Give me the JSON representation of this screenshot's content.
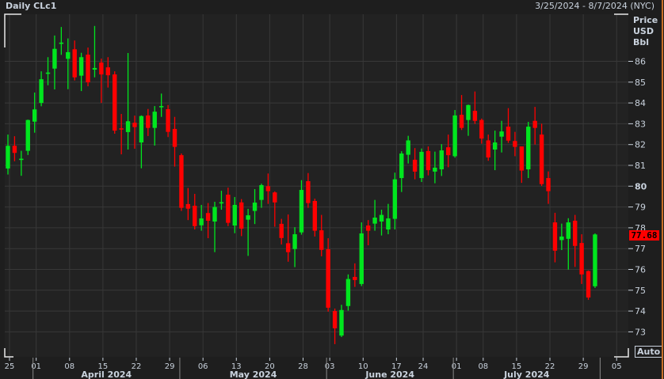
{
  "header": {
    "title": "Daily CLc1",
    "date_range": "3/25/2024 - 8/7/2024 (NYC)"
  },
  "axis_unit": [
    "Price",
    "USD",
    "Bbl"
  ],
  "auto_button": "Auto",
  "last_price": "77.68",
  "colors": {
    "up": "#00e61e",
    "down": "#ff0000",
    "background": "#222222",
    "grid": "#383838",
    "last_price_tag": "#ff0000",
    "axis_text": "#c9d2dd"
  },
  "chart_data": {
    "type": "candlestick",
    "title": "Daily CLc1",
    "ylabel": "Price USD Bbl",
    "ylim": [
      72.3,
      87.8
    ],
    "y_ticks": [
      73,
      74,
      75,
      76,
      77,
      78,
      79,
      80,
      81,
      82,
      83,
      84,
      85,
      86
    ],
    "grid": true,
    "x_ticks": [
      {
        "date": "2024-03-25",
        "label": "25"
      },
      {
        "date": "2024-04-01",
        "label": "01"
      },
      {
        "date": "2024-04-08",
        "label": "08"
      },
      {
        "date": "2024-04-15",
        "label": "15"
      },
      {
        "date": "2024-04-22",
        "label": "22"
      },
      {
        "date": "2024-04-29",
        "label": "29"
      },
      {
        "date": "2024-05-06",
        "label": "06"
      },
      {
        "date": "2024-05-13",
        "label": "13"
      },
      {
        "date": "2024-05-20",
        "label": "20"
      },
      {
        "date": "2024-05-28",
        "label": "28"
      },
      {
        "date": "2024-06-03",
        "label": "03"
      },
      {
        "date": "2024-06-10",
        "label": "10"
      },
      {
        "date": "2024-06-17",
        "label": "17"
      },
      {
        "date": "2024-06-24",
        "label": "24"
      },
      {
        "date": "2024-07-01",
        "label": "01"
      },
      {
        "date": "2024-07-08",
        "label": "08"
      },
      {
        "date": "2024-07-15",
        "label": "15"
      },
      {
        "date": "2024-07-22",
        "label": "22"
      },
      {
        "date": "2024-07-29",
        "label": "29"
      },
      {
        "date": "2024-08-05",
        "label": "05"
      }
    ],
    "months": [
      {
        "start": "2024-04-01",
        "label": "April 2024"
      },
      {
        "start": "2024-05-01",
        "label": "May 2024"
      },
      {
        "start": "2024-06-03",
        "label": "June 2024"
      },
      {
        "start": "2024-07-01",
        "label": "July 2024"
      },
      {
        "start": "2024-08-01",
        "label": ""
      }
    ],
    "columns": [
      "date",
      "open",
      "high",
      "low",
      "close"
    ],
    "candles": [
      [
        "2024-03-25",
        80.85,
        82.48,
        80.56,
        81.94
      ],
      [
        "2024-03-26",
        81.94,
        82.4,
        81.2,
        81.6
      ],
      [
        "2024-03-27",
        81.3,
        81.7,
        80.5,
        81.32
      ],
      [
        "2024-03-28",
        81.7,
        83.2,
        81.5,
        83.18
      ],
      [
        "2024-04-01",
        83.1,
        84.5,
        82.57,
        83.69
      ],
      [
        "2024-04-02",
        84.0,
        85.52,
        83.84,
        85.14
      ],
      [
        "2024-04-03",
        85.46,
        86.2,
        84.85,
        85.46
      ],
      [
        "2024-04-04",
        85.65,
        87.24,
        84.65,
        86.6
      ],
      [
        "2024-04-05",
        86.9,
        87.65,
        86.31,
        86.9
      ],
      [
        "2024-04-08",
        86.12,
        87.1,
        84.66,
        86.44
      ],
      [
        "2024-04-09",
        86.58,
        87.0,
        85.08,
        85.23
      ],
      [
        "2024-04-10",
        85.31,
        86.41,
        84.57,
        86.2
      ],
      [
        "2024-04-11",
        86.32,
        86.66,
        84.8,
        84.99
      ],
      [
        "2024-04-12",
        85.6,
        87.7,
        85.23,
        85.68
      ],
      [
        "2024-04-15",
        85.94,
        86.13,
        84.0,
        85.37
      ],
      [
        "2024-04-16",
        85.71,
        86.2,
        84.74,
        85.33
      ],
      [
        "2024-04-17",
        85.37,
        85.52,
        82.52,
        82.67
      ],
      [
        "2024-04-18",
        82.78,
        83.47,
        81.53,
        82.74
      ],
      [
        "2024-04-19",
        82.6,
        86.4,
        81.76,
        83.12
      ],
      [
        "2024-04-22",
        83.05,
        83.39,
        81.8,
        82.84
      ],
      [
        "2024-04-23",
        82.1,
        83.4,
        80.86,
        83.37
      ],
      [
        "2024-04-24",
        83.4,
        83.71,
        82.41,
        82.8
      ],
      [
        "2024-04-25",
        82.8,
        83.85,
        81.95,
        83.58
      ],
      [
        "2024-04-26",
        83.8,
        84.45,
        83.33,
        83.85
      ],
      [
        "2024-04-29",
        83.7,
        83.9,
        82.36,
        82.61
      ],
      [
        "2024-04-30",
        82.75,
        83.33,
        80.94,
        81.89
      ],
      [
        "2024-05-01",
        81.49,
        81.57,
        78.81,
        78.96
      ],
      [
        "2024-05-02",
        79.14,
        79.91,
        78.37,
        78.92
      ],
      [
        "2024-05-03",
        79.06,
        79.63,
        77.92,
        78.08
      ],
      [
        "2024-05-06",
        78.12,
        79.1,
        77.86,
        78.45
      ],
      [
        "2024-05-07",
        78.71,
        79.19,
        77.5,
        78.34
      ],
      [
        "2024-05-08",
        78.3,
        79.25,
        76.83,
        79.0
      ],
      [
        "2024-05-09",
        79.18,
        79.78,
        78.87,
        79.23
      ],
      [
        "2024-05-10",
        79.59,
        79.93,
        78.08,
        78.24
      ],
      [
        "2024-05-13",
        78.11,
        79.48,
        77.74,
        79.1
      ],
      [
        "2024-05-14",
        79.22,
        79.38,
        77.6,
        77.96
      ],
      [
        "2024-05-15",
        78.39,
        78.91,
        76.65,
        78.6
      ],
      [
        "2024-05-16",
        78.81,
        79.86,
        78.18,
        79.21
      ],
      [
        "2024-05-17",
        79.34,
        80.12,
        78.96,
        80.05
      ],
      [
        "2024-05-20",
        80.0,
        80.61,
        79.15,
        79.76
      ],
      [
        "2024-05-21",
        79.7,
        79.75,
        78.05,
        79.22
      ],
      [
        "2024-05-22",
        78.19,
        78.43,
        77.2,
        77.51
      ],
      [
        "2024-05-23",
        77.26,
        78.64,
        76.37,
        76.83
      ],
      [
        "2024-05-24",
        76.98,
        78.03,
        76.11,
        77.69
      ],
      [
        "2024-05-28",
        77.78,
        80.29,
        77.67,
        79.82
      ],
      [
        "2024-05-29",
        80.24,
        80.63,
        78.96,
        79.19
      ],
      [
        "2024-05-30",
        79.29,
        79.4,
        77.58,
        77.86
      ],
      [
        "2024-05-31",
        77.88,
        78.62,
        76.63,
        76.94
      ],
      [
        "2024-06-03",
        76.97,
        77.5,
        73.97,
        74.16
      ],
      [
        "2024-06-04",
        74.0,
        74.12,
        72.41,
        73.17
      ],
      [
        "2024-06-05",
        72.82,
        74.3,
        72.75,
        74.05
      ],
      [
        "2024-06-06",
        74.24,
        75.76,
        74.02,
        75.54
      ],
      [
        "2024-06-07",
        75.64,
        76.29,
        75.16,
        75.49
      ],
      [
        "2024-06-10",
        75.3,
        78.26,
        75.2,
        77.73
      ],
      [
        "2024-06-11",
        78.11,
        78.37,
        77.16,
        77.86
      ],
      [
        "2024-06-12",
        78.2,
        79.34,
        77.86,
        78.49
      ],
      [
        "2024-06-13",
        78.3,
        78.87,
        77.63,
        78.62
      ],
      [
        "2024-06-14",
        77.92,
        79.15,
        77.69,
        78.45
      ],
      [
        "2024-06-17",
        78.43,
        80.65,
        77.92,
        80.33
      ],
      [
        "2024-06-18",
        80.39,
        81.68,
        79.72,
        81.57
      ],
      [
        "2024-06-20",
        81.51,
        82.42,
        81.09,
        82.2
      ],
      [
        "2024-06-21",
        81.27,
        81.83,
        80.33,
        80.7
      ],
      [
        "2024-06-24",
        80.39,
        81.81,
        80.2,
        81.65
      ],
      [
        "2024-06-25",
        81.69,
        81.91,
        80.52,
        80.77
      ],
      [
        "2024-06-26",
        80.7,
        81.66,
        80.14,
        80.89
      ],
      [
        "2024-06-27",
        80.81,
        82.02,
        80.49,
        81.72
      ],
      [
        "2024-06-28",
        81.87,
        82.48,
        80.91,
        81.49
      ],
      [
        "2024-07-01",
        81.44,
        83.66,
        81.37,
        83.4
      ],
      [
        "2024-07-02",
        83.43,
        84.38,
        82.7,
        82.8
      ],
      [
        "2024-07-03",
        83.18,
        83.92,
        82.42,
        83.9
      ],
      [
        "2024-07-05",
        83.62,
        84.55,
        82.99,
        83.14
      ],
      [
        "2024-07-08",
        83.18,
        83.25,
        82.04,
        82.29
      ],
      [
        "2024-07-09",
        82.2,
        82.48,
        81.22,
        81.38
      ],
      [
        "2024-07-10",
        81.76,
        82.67,
        80.77,
        82.1
      ],
      [
        "2024-07-11",
        82.38,
        83.14,
        81.62,
        82.63
      ],
      [
        "2024-07-12",
        82.86,
        83.75,
        82.08,
        82.19
      ],
      [
        "2024-07-15",
        82.17,
        82.61,
        81.44,
        81.89
      ],
      [
        "2024-07-16",
        81.91,
        81.91,
        80.16,
        80.75
      ],
      [
        "2024-07-17",
        80.81,
        83.09,
        80.39,
        82.86
      ],
      [
        "2024-07-18",
        83.14,
        83.81,
        82.0,
        82.8
      ],
      [
        "2024-07-19",
        82.48,
        83.0,
        80.01,
        80.1
      ],
      [
        "2024-07-22",
        80.39,
        80.71,
        79.15,
        79.76
      ],
      [
        "2024-07-23",
        78.26,
        78.72,
        76.34,
        76.9
      ],
      [
        "2024-07-24",
        77.41,
        78.2,
        76.93,
        77.58
      ],
      [
        "2024-07-25",
        77.47,
        78.46,
        75.99,
        78.26
      ],
      [
        "2024-07-26",
        78.34,
        78.62,
        76.12,
        77.13
      ],
      [
        "2024-07-29",
        77.27,
        77.69,
        75.3,
        75.76
      ],
      [
        "2024-07-30",
        75.92,
        75.95,
        74.54,
        74.65
      ],
      [
        "2024-07-31",
        75.19,
        77.73,
        75.11,
        77.68
      ]
    ]
  }
}
